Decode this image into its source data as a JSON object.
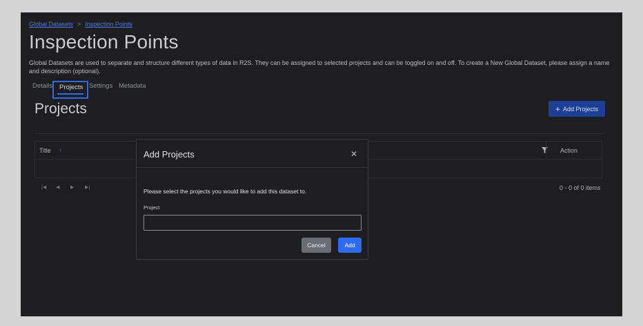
{
  "breadcrumb": {
    "items": [
      "Global Datasets",
      "Inspection Points"
    ],
    "separator": ">"
  },
  "page": {
    "title": "Inspection Points",
    "description": "Global Datasets are used to separate and structure different types of data in R2S. They can be assigned to selected projects and can be toggled on and off. To create a New Global Dataset, please assign a name and description (optional)."
  },
  "tabs": [
    {
      "label": "Details",
      "active": false
    },
    {
      "label": "Projects",
      "active": true
    },
    {
      "label": "Settings",
      "active": false
    },
    {
      "label": "Metadata",
      "active": false
    }
  ],
  "projects_section": {
    "title": "Projects",
    "add_button": {
      "icon": "plus-icon",
      "label": "Add Projects"
    }
  },
  "grid": {
    "columns": [
      {
        "label": "Title",
        "sort": "ascending",
        "sort_icon": "arrow-up-icon"
      },
      {
        "label": "Action"
      }
    ],
    "filter_icon": "filter-icon",
    "pager": {
      "icons": [
        "first-page-icon",
        "prev-page-icon",
        "next-page-icon",
        "last-page-icon"
      ],
      "info": "0 - 0 of 0 items"
    }
  },
  "modal": {
    "title": "Add Projects",
    "close_icon": "close-icon",
    "message": "Please select the projects you would like to add this dataset to.",
    "field_label": "Project",
    "field_value": "",
    "cancel_label": "Cancel",
    "add_label": "Add"
  },
  "colors": {
    "accent": "#2d6cf0",
    "background": "#1e1e20",
    "add_projects_button": "#1d3f96"
  }
}
